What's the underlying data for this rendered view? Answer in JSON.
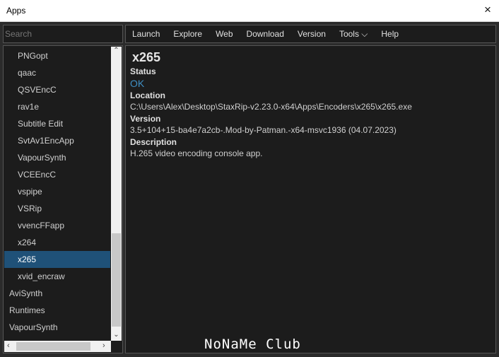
{
  "window": {
    "title": "Apps",
    "close_icon": "×"
  },
  "search": {
    "placeholder": "Search"
  },
  "menu": [
    "Launch",
    "Explore",
    "Web",
    "Download",
    "Version",
    "Tools ⌵",
    "Help"
  ],
  "list": {
    "items": [
      {
        "label": "PNGopt",
        "level": 1
      },
      {
        "label": "qaac",
        "level": 1
      },
      {
        "label": "QSVEncC",
        "level": 1
      },
      {
        "label": "rav1e",
        "level": 1
      },
      {
        "label": "Subtitle Edit",
        "level": 1
      },
      {
        "label": "SvtAv1EncApp",
        "level": 1
      },
      {
        "label": "VapourSynth",
        "level": 1
      },
      {
        "label": "VCEEncC",
        "level": 1
      },
      {
        "label": "vspipe",
        "level": 1
      },
      {
        "label": "VSRip",
        "level": 1
      },
      {
        "label": "vvencFFapp",
        "level": 1
      },
      {
        "label": "x264",
        "level": 1
      },
      {
        "label": "x265",
        "level": 1,
        "selected": true
      },
      {
        "label": "xvid_encraw",
        "level": 1
      },
      {
        "label": "AviSynth",
        "level": 0
      },
      {
        "label": "Runtimes",
        "level": 0
      },
      {
        "label": "VapourSynth",
        "level": 0
      }
    ],
    "scroll_position_fraction": 0.9
  },
  "detail": {
    "title": "x265",
    "status_label": "Status",
    "status": "OK",
    "location_label": "Location",
    "location": "C:\\Users\\Alex\\Desktop\\StaxRip-v2.23.0-x64\\Apps\\Encoders\\x265\\x265.exe",
    "version_label": "Version",
    "version": "3.5+104+15-ba4e7a2cb-.Mod-by-Patman.-x64-msvc1936 (04.07.2023)",
    "description_label": "Description",
    "description": "H.265 video encoding console app."
  },
  "watermark": "NoNaMe Club",
  "colors": {
    "selected": "#1f5178",
    "ok": "#3f8fc4"
  }
}
